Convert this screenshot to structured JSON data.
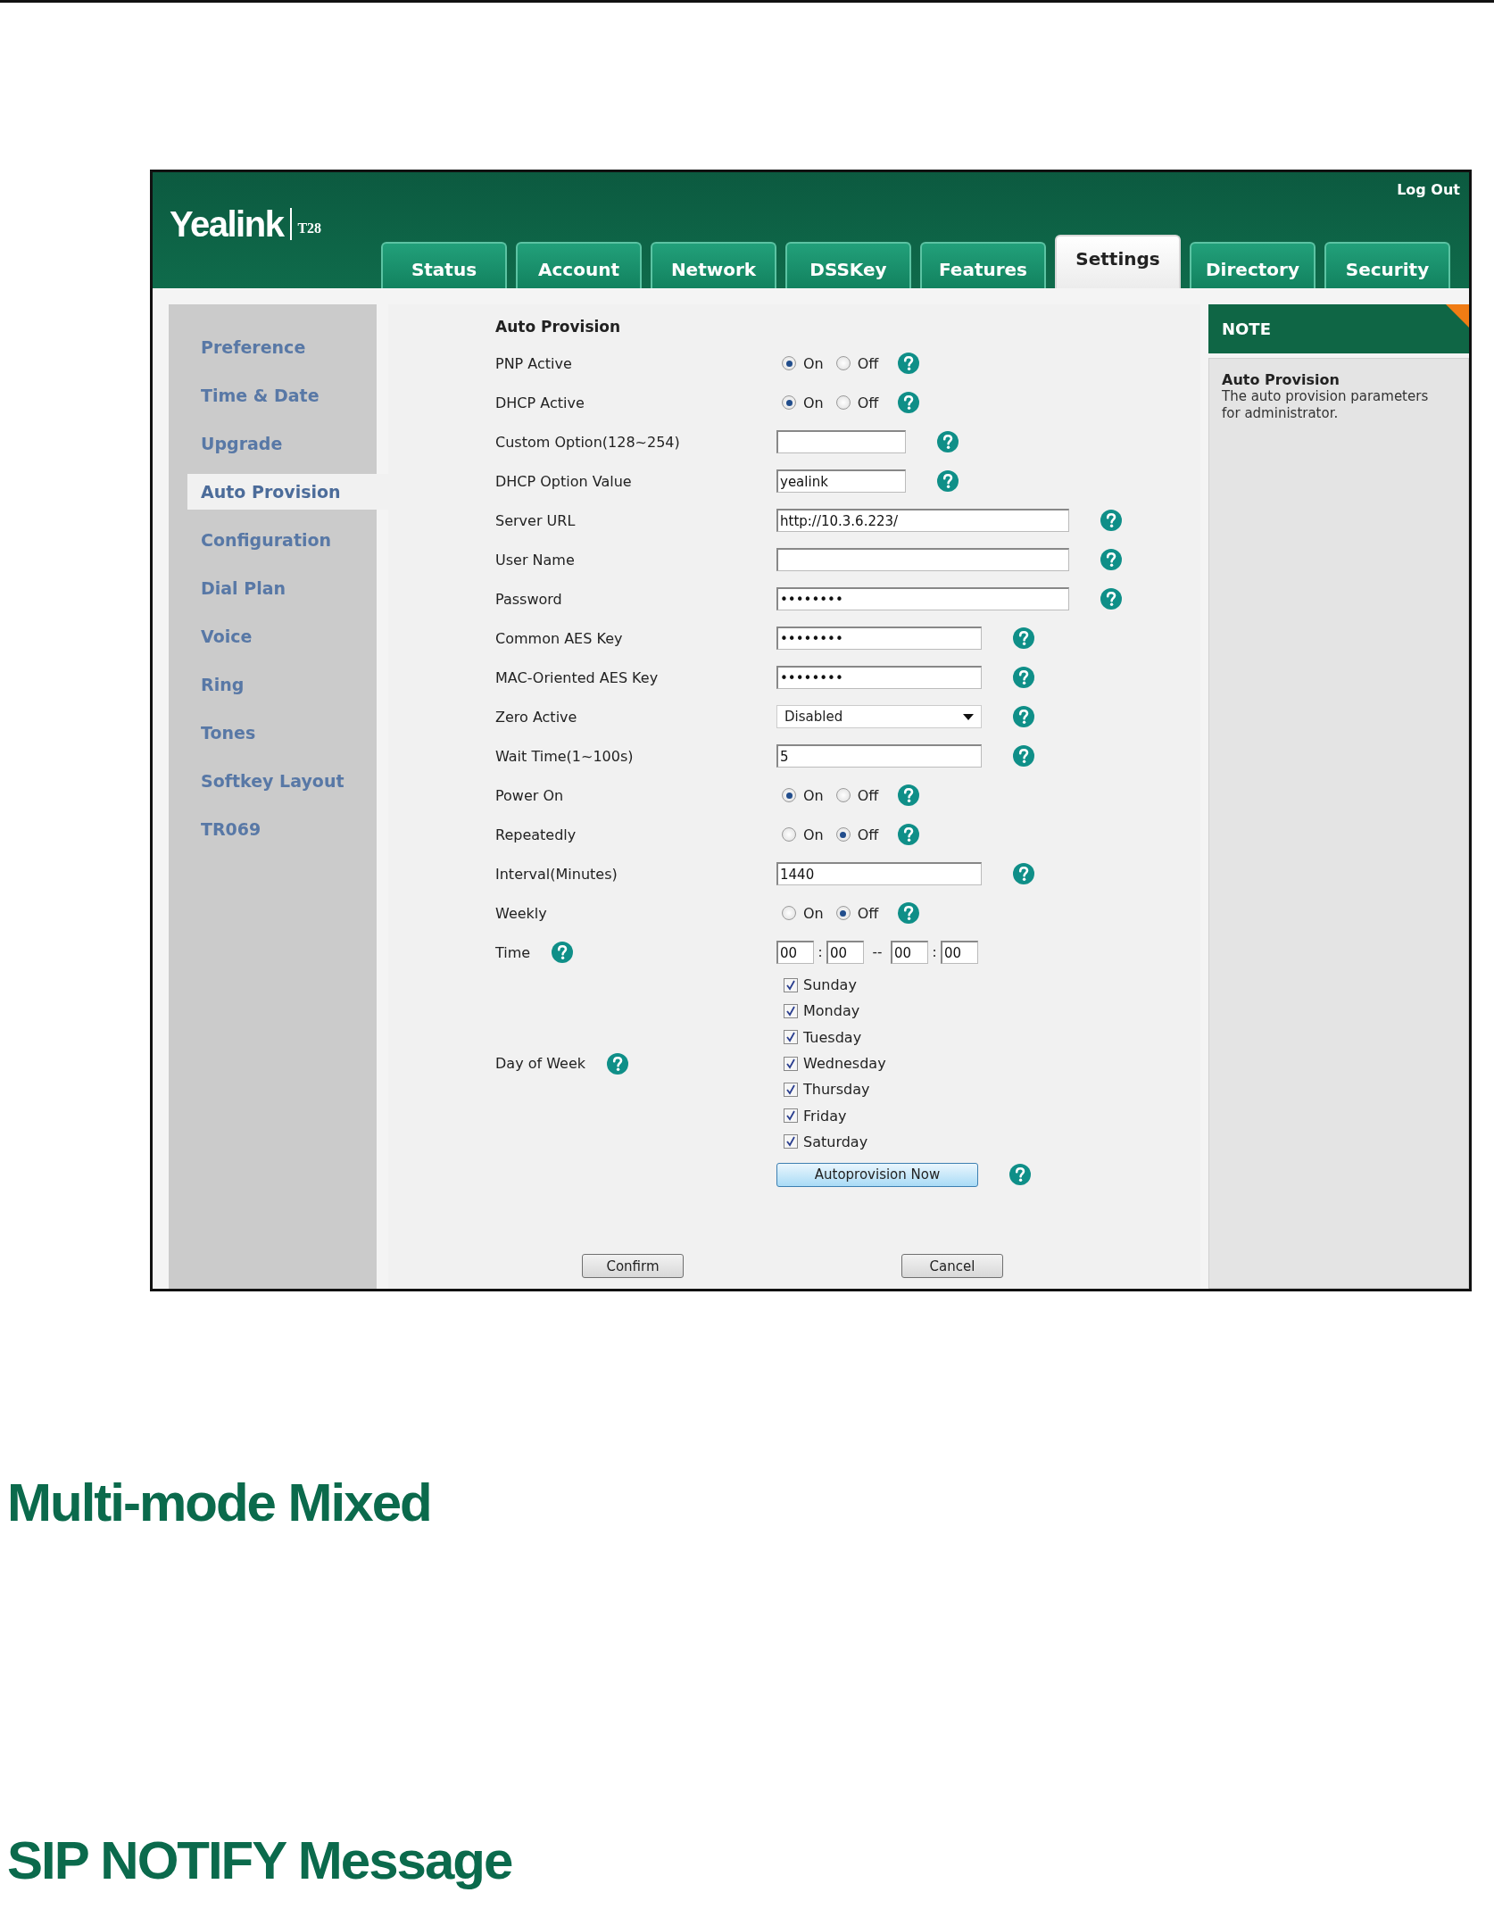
{
  "header": {
    "logo": "Yealink",
    "model": "T28",
    "logout": "Log Out"
  },
  "tabs": [
    {
      "label": "Status",
      "selected": false
    },
    {
      "label": "Account",
      "selected": false
    },
    {
      "label": "Network",
      "selected": false
    },
    {
      "label": "DSSKey",
      "selected": false
    },
    {
      "label": "Features",
      "selected": false
    },
    {
      "label": "Settings",
      "selected": true
    },
    {
      "label": "Directory",
      "selected": false
    },
    {
      "label": "Security",
      "selected": false
    }
  ],
  "sidebar": {
    "items": [
      {
        "label": "Preference",
        "selected": false
      },
      {
        "label": "Time & Date",
        "selected": false
      },
      {
        "label": "Upgrade",
        "selected": false
      },
      {
        "label": "Auto Provision",
        "selected": true
      },
      {
        "label": "Configuration",
        "selected": false
      },
      {
        "label": "Dial Plan",
        "selected": false
      },
      {
        "label": "Voice",
        "selected": false
      },
      {
        "label": "Ring",
        "selected": false
      },
      {
        "label": "Tones",
        "selected": false
      },
      {
        "label": "Softkey Layout",
        "selected": false
      },
      {
        "label": "TR069",
        "selected": false
      }
    ]
  },
  "form": {
    "title": "Auto Provision",
    "rows": [
      {
        "kind": "radio",
        "label": "PNP Active",
        "options": [
          {
            "label": "On",
            "selected": true
          },
          {
            "label": "Off",
            "selected": false
          }
        ]
      },
      {
        "kind": "radio",
        "label": "DHCP Active",
        "options": [
          {
            "label": "On",
            "selected": true
          },
          {
            "label": "Off",
            "selected": false
          }
        ]
      },
      {
        "kind": "field",
        "label": "Custom Option(128~254)"
      },
      {
        "kind": "field",
        "label": "DHCP Option Value",
        "value": "yealink"
      },
      {
        "kind": "field",
        "label": "Server URL",
        "value": "http://10.3.6.223/"
      },
      {
        "kind": "field",
        "label": "User Name"
      },
      {
        "kind": "field",
        "label": "Password",
        "value": "••••••••"
      },
      {
        "kind": "field",
        "label": "Common AES Key",
        "value": "••••••••"
      },
      {
        "kind": "field",
        "label": "MAC-Oriented AES Key",
        "value": "••••••••"
      },
      {
        "kind": "select",
        "label": "Zero Active",
        "value": "Disabled"
      },
      {
        "kind": "field",
        "label": "Wait Time(1~100s)",
        "value": "5"
      },
      {
        "kind": "radio",
        "label": "Power On",
        "options": [
          {
            "label": "On",
            "selected": true
          },
          {
            "label": "Off",
            "selected": false
          }
        ]
      },
      {
        "kind": "radio",
        "label": "Repeatedly",
        "options": [
          {
            "label": "On",
            "selected": false
          },
          {
            "label": "Off",
            "selected": true
          }
        ]
      },
      {
        "kind": "field",
        "label": "Interval(Minutes)",
        "value": "1440"
      },
      {
        "kind": "radio",
        "label": "Weekly",
        "options": [
          {
            "label": "On",
            "selected": false
          },
          {
            "label": "Off",
            "selected": true
          }
        ]
      },
      {
        "kind": "time",
        "label": "Time",
        "values": [
          "00",
          "00",
          "00",
          "00"
        ],
        "separators": [
          ":",
          "--",
          ":"
        ]
      },
      {
        "kind": "days",
        "label": "Day of Week",
        "days": [
          {
            "label": "Sunday",
            "checked": true
          },
          {
            "label": "Monday",
            "checked": true
          },
          {
            "label": "Tuesday",
            "checked": true
          },
          {
            "label": "Wednesday",
            "checked": true
          },
          {
            "label": "Thursday",
            "checked": true
          },
          {
            "label": "Friday",
            "checked": true
          },
          {
            "label": "Saturday",
            "checked": true
          }
        ]
      },
      {
        "kind": "action",
        "label": "Autoprovision Now"
      }
    ]
  },
  "buttons": [
    "Confirm",
    "Cancel"
  ],
  "note": {
    "title": "NOTE",
    "heading": "Auto Provision",
    "text": "The auto provision parameters for administrator."
  },
  "headings": [
    "Multi-mode Mixed",
    "SIP NOTIFY Message"
  ]
}
